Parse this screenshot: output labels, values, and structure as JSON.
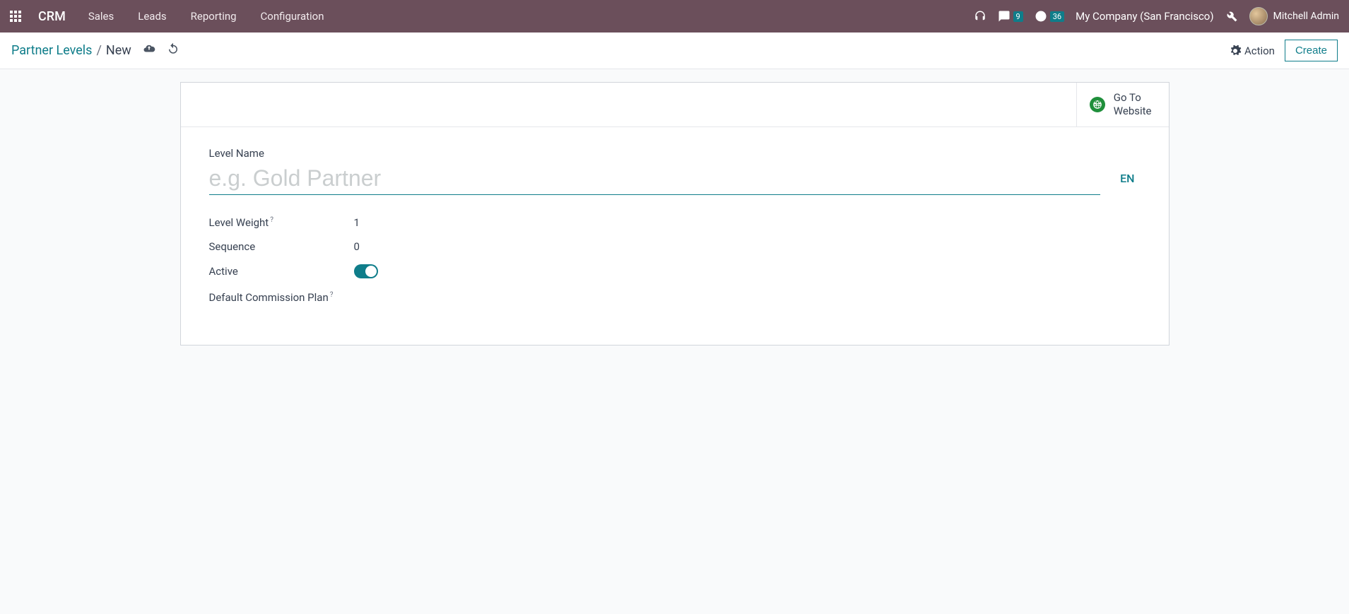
{
  "topnav": {
    "app_title": "CRM",
    "menu": [
      "Sales",
      "Leads",
      "Reporting",
      "Configuration"
    ],
    "messages_count": "9",
    "activities_count": "36",
    "company": "My Company (San Francisco)",
    "user_name": "Mitchell Admin"
  },
  "controlbar": {
    "breadcrumb_root": "Partner Levels",
    "breadcrumb_current": "New",
    "action_label": "Action",
    "create_label": "Create"
  },
  "sheet": {
    "goto_line1": "Go To",
    "goto_line2": "Website",
    "level_name_label": "Level Name",
    "level_name_placeholder": "e.g. Gold Partner",
    "level_name_value": "",
    "lang_button": "EN",
    "level_weight_label": "Level Weight",
    "level_weight_value": "1",
    "sequence_label": "Sequence",
    "sequence_value": "0",
    "active_label": "Active",
    "active_value": true,
    "commission_label": "Default Commission Plan"
  }
}
